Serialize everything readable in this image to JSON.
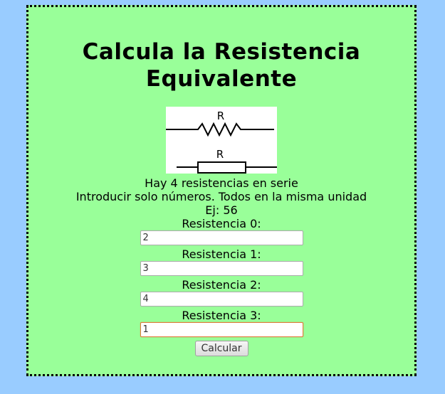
{
  "page": {
    "title": "Calcula la Resistencia Equivalente",
    "title_line1": "Calcula la Resistencia",
    "title_line2": "Equivalente",
    "colors": {
      "background": "#99ccff",
      "panel": "#99ff99",
      "border": "#000000"
    }
  },
  "diagram": {
    "label_top": "R",
    "label_bottom": "R"
  },
  "info": {
    "count_text": "Hay 4 resistencias en serie",
    "instruction": "Introducir solo números. Todos en la misma unidad",
    "example": "Ej: 56"
  },
  "fields": [
    {
      "label": "Resistencia 0:",
      "value": "2"
    },
    {
      "label": "Resistencia 1:",
      "value": "3"
    },
    {
      "label": "Resistencia 2:",
      "value": "4"
    },
    {
      "label": "Resistencia 3:",
      "value": "1"
    }
  ],
  "actions": {
    "calculate_label": "Calcular"
  }
}
